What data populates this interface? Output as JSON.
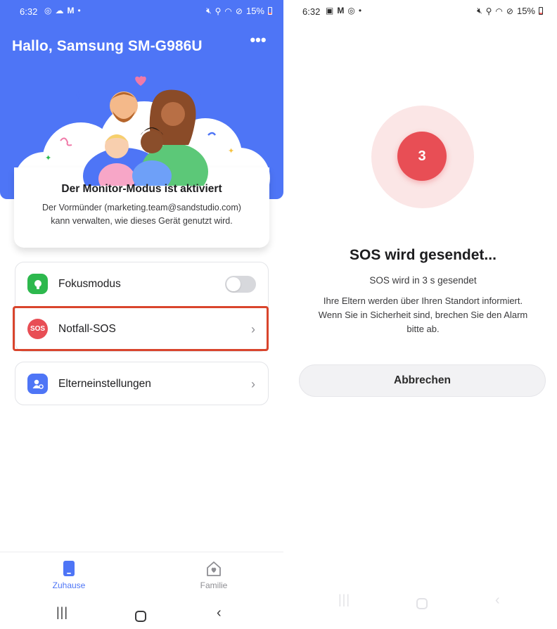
{
  "left_screen": {
    "status_bar": {
      "time": "6:32",
      "icons_left": [
        "focus-icon",
        "weather-icon",
        "gmail-icon",
        "dot"
      ],
      "icons_right": [
        "mute-icon",
        "location-icon",
        "wifi-icon",
        "no-disturb-icon"
      ],
      "battery": "15%"
    },
    "greeting": "Hallo, Samsung SM-G986U",
    "more_label": "•••",
    "monitor_card": {
      "title": "Der Monitor-Modus ist aktiviert",
      "description_line1": "Der Vormünder (marketing.team@sandstudio.com)",
      "description_line2": "kann verwalten, wie dieses Gerät genutzt wird."
    },
    "settings": {
      "focus_mode": {
        "label": "Fokusmodus",
        "enabled": false
      },
      "emergency_sos": {
        "label": "Notfall-SOS",
        "icon_text": "SOS"
      },
      "parent_settings": {
        "label": "Elterneinstellungen"
      }
    },
    "bottom_nav": [
      {
        "label": "Zuhause",
        "active": true
      },
      {
        "label": "Familie",
        "active": false
      }
    ],
    "colors": {
      "header_blue": "#4e75f6",
      "highlight_red": "#d9452d",
      "focus_green": "#2db84d",
      "sos_red": "#e84e55"
    }
  },
  "right_screen": {
    "status_bar": {
      "time": "6:32",
      "battery": "15%"
    },
    "countdown": "3",
    "title": "SOS wird gesendet...",
    "subtitle": "SOS wird in 3 s gesendet",
    "description_line1": "Ihre Eltern werden über Ihren Standort informiert.",
    "description_line2": "Wenn Sie in Sicherheit sind, brechen Sie den Alarm",
    "description_line3": "bitte ab.",
    "cancel_button": "Abbrechen"
  }
}
